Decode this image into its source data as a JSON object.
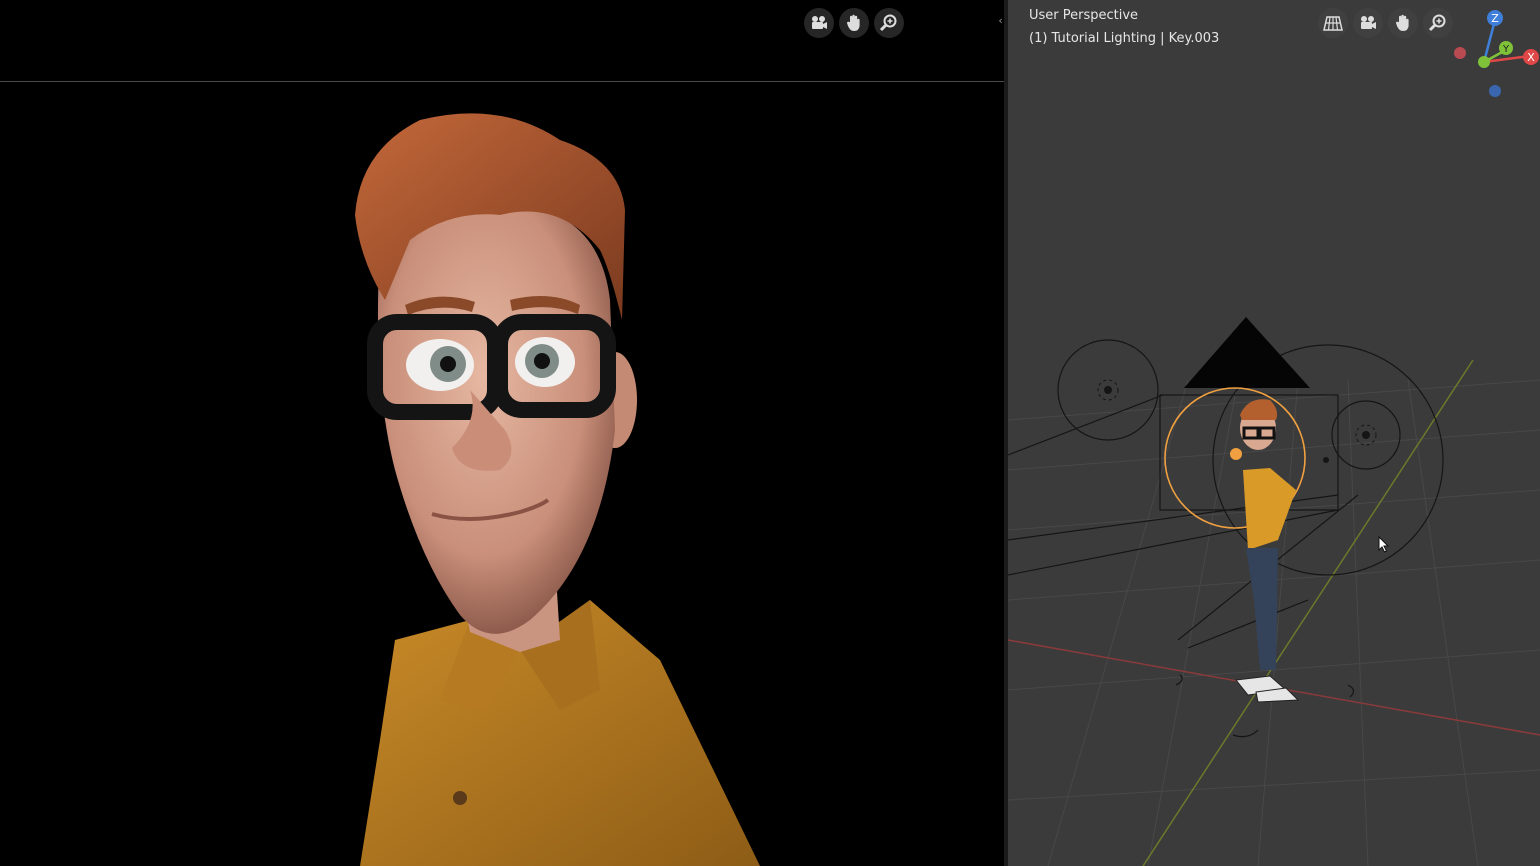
{
  "left_viewport": {
    "toolbar": [
      {
        "icon": "camera-view-icon"
      },
      {
        "icon": "pan-hand-icon"
      },
      {
        "icon": "zoom-icon"
      }
    ]
  },
  "right_viewport": {
    "perspective_label": "User Perspective",
    "object_label": "(1) Tutorial Lighting | Key.003",
    "toolbar": [
      {
        "icon": "perspective-grid-icon"
      },
      {
        "icon": "camera-view-icon"
      },
      {
        "icon": "pan-hand-icon"
      },
      {
        "icon": "zoom-icon"
      }
    ],
    "gizmo": {
      "x_label": "X",
      "y_label": "Y",
      "z_label": "Z"
    }
  },
  "colors": {
    "axis_x": "#e04848",
    "axis_y": "#7fc23a",
    "axis_z": "#3f7fd9",
    "selection": "#f0a040",
    "viewport_bg": "#3b3b3b"
  }
}
